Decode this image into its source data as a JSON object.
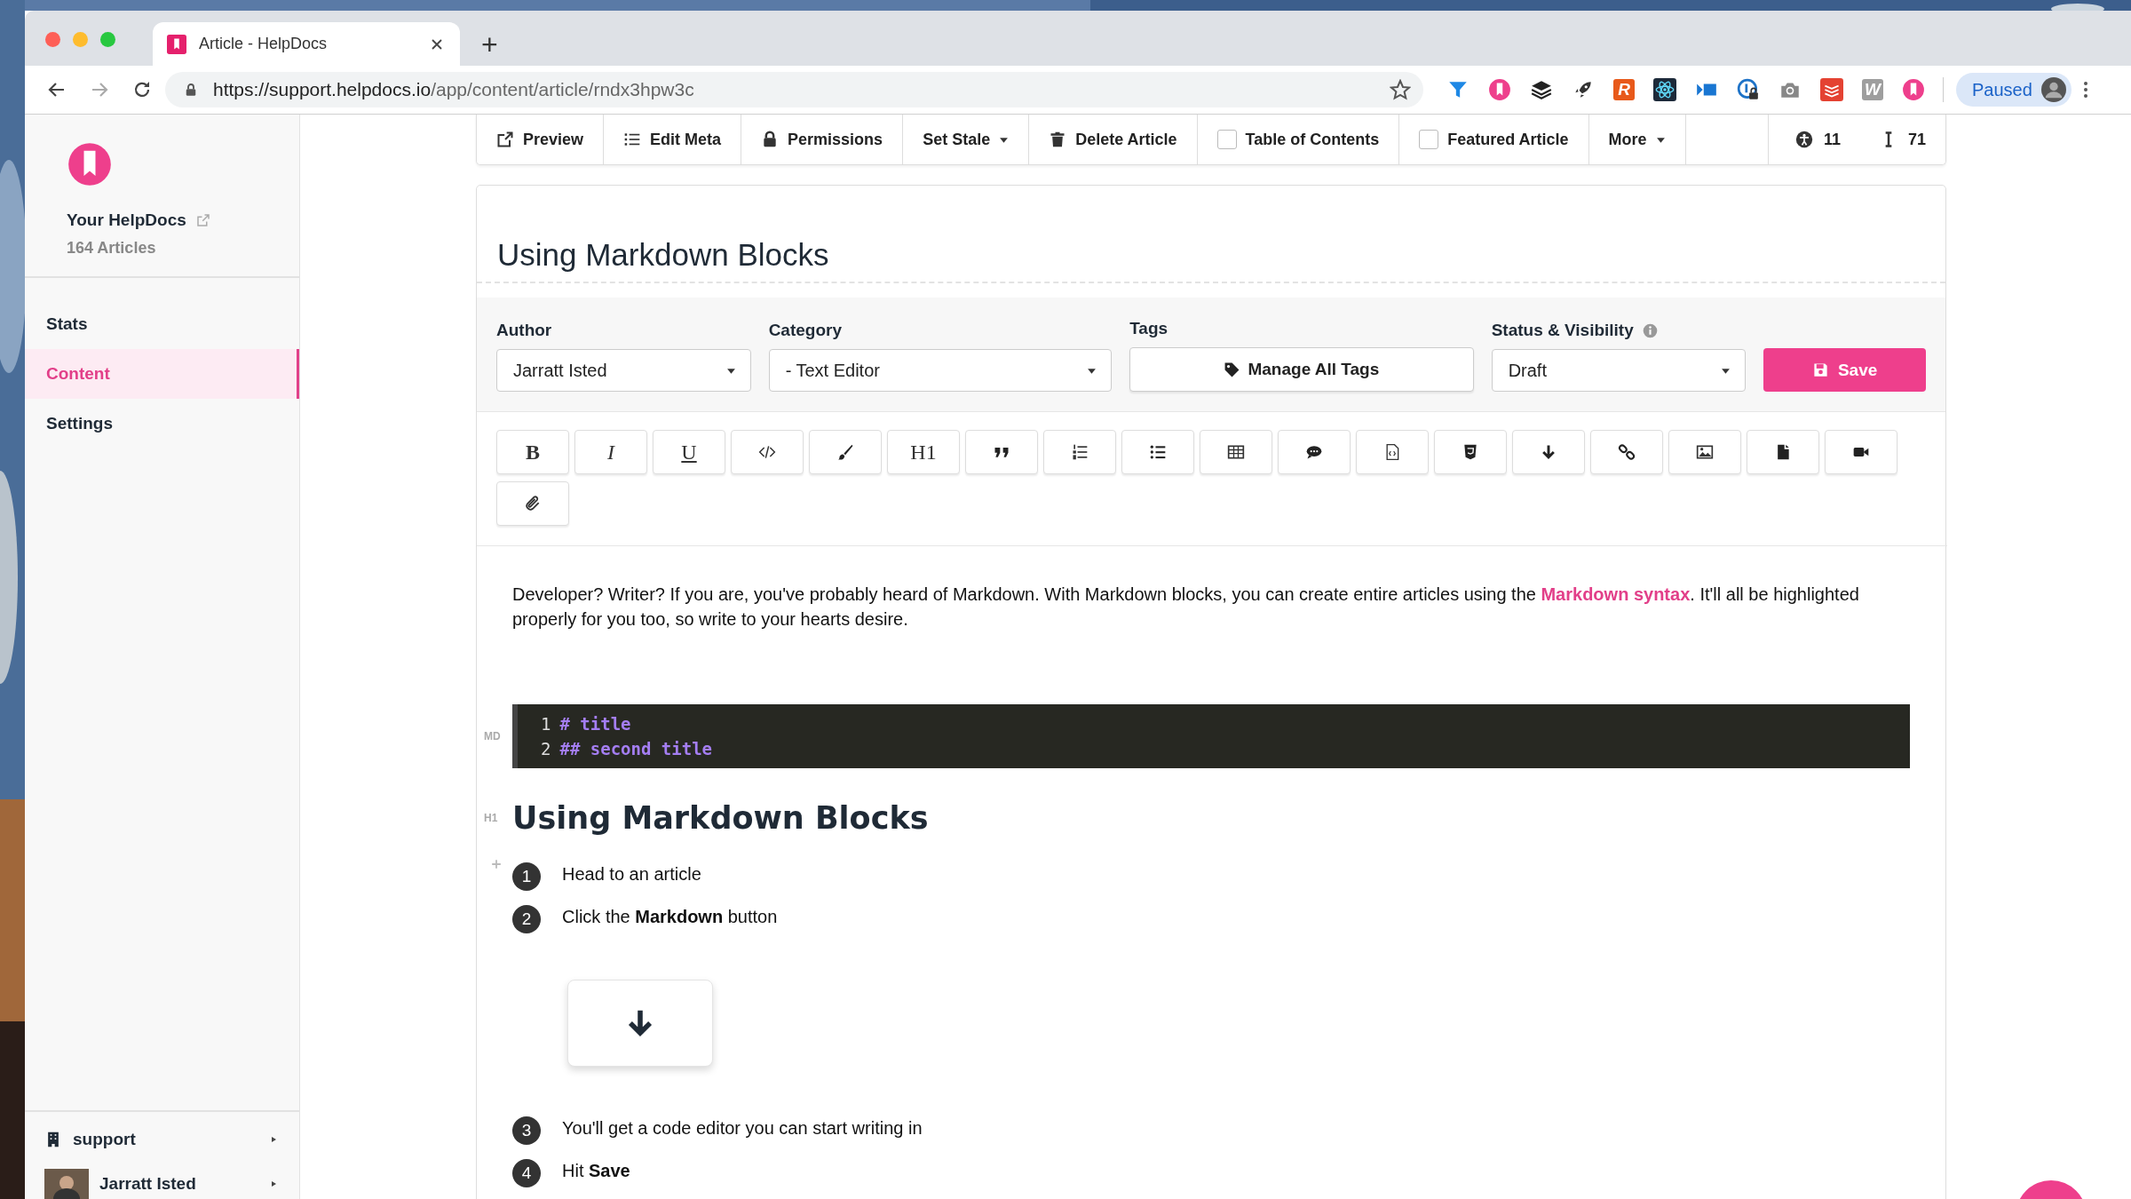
{
  "browser": {
    "tab_title": "Article - HelpDocs",
    "new_tab": "+",
    "url_host": "https://support.helpdocs.io",
    "url_path": "/app/content/article/rndx3hpw3c",
    "profile": "Paused",
    "extensions": [
      {
        "kind": "funnel"
      },
      {
        "kind": "helpdocs"
      },
      {
        "kind": "layers"
      },
      {
        "kind": "rocket"
      },
      {
        "kind": "letter",
        "label": "R",
        "color": "#e8591a"
      },
      {
        "kind": "atom"
      },
      {
        "kind": "flag"
      },
      {
        "kind": "lock"
      },
      {
        "kind": "camera"
      },
      {
        "kind": "todo"
      },
      {
        "kind": "letter",
        "label": "W",
        "color": "#9e9e9e"
      },
      {
        "kind": "helpdocs"
      }
    ]
  },
  "sidebar": {
    "brand": "Your HelpDocs",
    "count": "164 Articles",
    "nav": [
      {
        "label": "Stats",
        "selected": false
      },
      {
        "label": "Content",
        "selected": true
      },
      {
        "label": "Settings",
        "selected": false
      }
    ],
    "account": "support",
    "user": "Jarratt Isted"
  },
  "actions": [
    {
      "kind": "button",
      "label": "Preview"
    },
    {
      "kind": "button",
      "label": "Edit Meta"
    },
    {
      "kind": "button",
      "label": "Permissions"
    },
    {
      "kind": "dropdown",
      "label": "Set Stale"
    },
    {
      "kind": "button",
      "label": "Delete Article"
    },
    {
      "kind": "checkbox",
      "label": "Table of Contents",
      "checked": false
    },
    {
      "kind": "checkbox",
      "label": "Featured Article",
      "checked": false
    },
    {
      "kind": "dropdown",
      "label": "More"
    }
  ],
  "stats": [
    {
      "value": "11"
    },
    {
      "value": "71"
    }
  ],
  "article": {
    "title": "Using Markdown Blocks",
    "fields": [
      {
        "kind": "select",
        "label": "Author",
        "value": "Jarratt Isted"
      },
      {
        "kind": "select",
        "label": "Category",
        "value": "- Text Editor"
      },
      {
        "kind": "tags",
        "label": "Tags",
        "value": "Manage All Tags"
      },
      {
        "kind": "select",
        "label": "Status & Visibility",
        "value": "Draft",
        "info": true
      }
    ],
    "save": "Save",
    "format_buttons": [
      {
        "kind": "text",
        "label": "B"
      },
      {
        "kind": "text",
        "label": "I"
      },
      {
        "kind": "text",
        "label": "U"
      },
      {
        "kind": "icon"
      },
      {
        "kind": "icon"
      },
      {
        "kind": "text",
        "label": "H1"
      },
      {
        "kind": "icon"
      },
      {
        "kind": "icon"
      },
      {
        "kind": "icon"
      },
      {
        "kind": "icon"
      },
      {
        "kind": "icon"
      },
      {
        "kind": "icon"
      },
      {
        "kind": "icon"
      },
      {
        "kind": "icon"
      },
      {
        "kind": "icon"
      },
      {
        "kind": "icon"
      },
      {
        "kind": "icon"
      },
      {
        "kind": "icon"
      },
      {
        "kind": "icon"
      }
    ],
    "intro": {
      "before": "Developer? Writer? If you are, you've probably heard of Markdown. With Markdown blocks, you can create entire articles using the ",
      "link": "Markdown syntax",
      "after": ". It'll all be highlighted properly for you too, so write to your hearts desire."
    },
    "code_block": {
      "tag": "MD",
      "lines": [
        {
          "number": "1",
          "code": "# title"
        },
        {
          "number": "2",
          "code": "## second title"
        }
      ]
    },
    "heading": {
      "tag": "H1",
      "text": "Using Markdown Blocks"
    },
    "steps": [
      {
        "number": "1",
        "text": "Head to an article"
      },
      {
        "number": "2",
        "text": "Click the **Markdown** button",
        "image": true
      },
      {
        "number": "3",
        "text": "You'll get a code editor you can start writing in"
      },
      {
        "number": "4",
        "text": "Hit **Save**"
      }
    ]
  }
}
